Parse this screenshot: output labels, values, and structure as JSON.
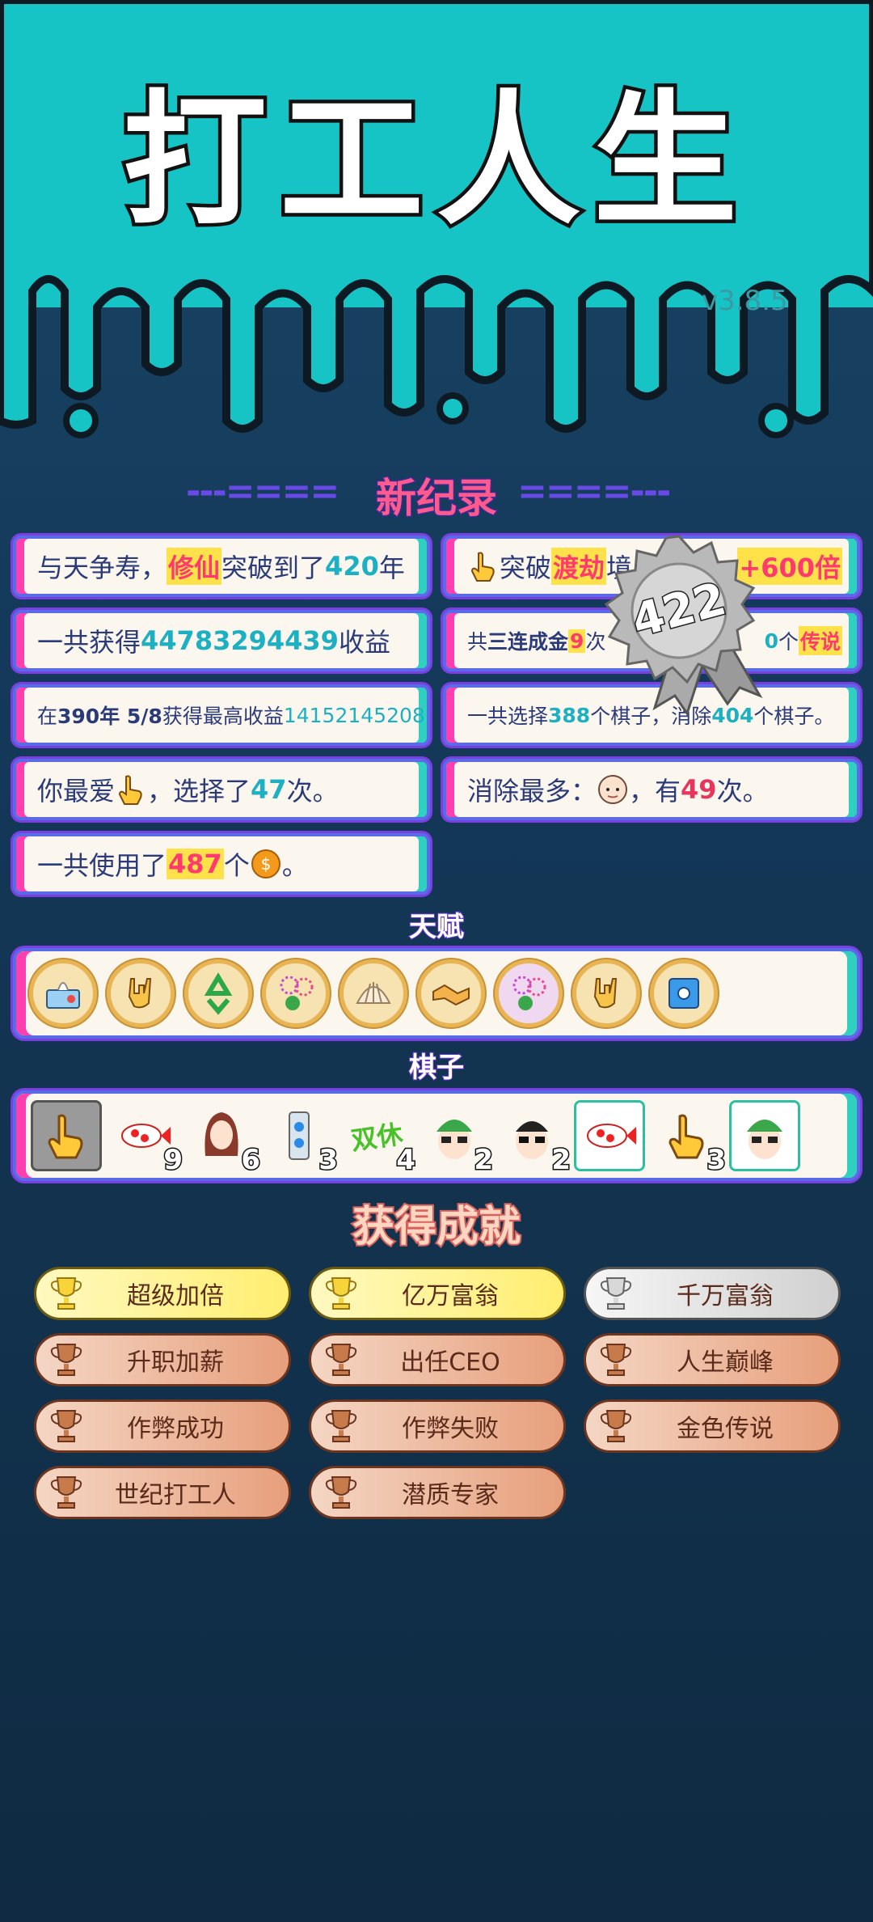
{
  "header": {
    "title": "打工人生",
    "version": "v3.8.5"
  },
  "records": {
    "section_title": "新纪录",
    "deco_left": "---====",
    "deco_right": "====---",
    "badge_number": "422",
    "rows": [
      {
        "pre": "与天争寿，",
        "gold": "修仙",
        "mid": "突破到了",
        "hl": "420",
        "post": "年"
      },
      {
        "pre": "突破",
        "gold": "渡劫",
        "mid": "境",
        "hl": "",
        "post": "+600倍"
      },
      {
        "pre": "一共获得",
        "hl": "44783294439",
        "post": "收益"
      },
      {
        "pre": "共",
        "bold": "三连成金",
        "num": "9",
        "mid": "次",
        "num2": "0",
        "post": "个",
        "gold": "传说"
      },
      {
        "pre": "在 ",
        "bold": "390年 5/8",
        "mid": " 获得最高收益",
        "hl": "14152145208"
      },
      {
        "pre": "一共选择",
        "hl": "388",
        "mid": "个棋子，消除",
        "hl2": "404",
        "post": "个棋子。"
      },
      {
        "pre": "你最爱",
        "mid": "，选择了",
        "hl": "47",
        "post": "次。"
      },
      {
        "pre": "消除最多：",
        "mid": "，有",
        "red": "49",
        "post": "次。"
      },
      {
        "pre": "一共使用了",
        "gold": "487",
        "post": "个",
        "end": "。"
      }
    ]
  },
  "talents": {
    "title": "天赋",
    "icons": [
      "tissue-icon",
      "rock-hand-icon",
      "recycle-icon",
      "fireworks-icon",
      "shell-icon",
      "handshake-icon",
      "fireworks-icon",
      "rock-hand-icon",
      "safe-icon"
    ]
  },
  "pieces": {
    "title": "棋子",
    "items": [
      {
        "icon": "pointer-hand-icon",
        "count": ""
      },
      {
        "icon": "koi-fish-icon",
        "count": "9"
      },
      {
        "icon": "girl-avatar-icon",
        "count": "6"
      },
      {
        "icon": "snowflake-can-icon",
        "count": "3"
      },
      {
        "icon": "double-rest-icon",
        "label": "双休",
        "count": "4"
      },
      {
        "icon": "green-hat-man-icon",
        "count": "2"
      },
      {
        "icon": "sunglasses-man-icon",
        "count": "2"
      },
      {
        "icon": "koi-fish-icon",
        "count": ""
      },
      {
        "icon": "pointer-hand-icon",
        "count": "3"
      },
      {
        "icon": "green-hat-man-icon",
        "count": ""
      }
    ]
  },
  "achievements": {
    "title": "获得成就",
    "items": [
      {
        "label": "超级加倍",
        "tier": "gold"
      },
      {
        "label": "亿万富翁",
        "tier": "gold"
      },
      {
        "label": "千万富翁",
        "tier": "silver"
      },
      {
        "label": "升职加薪",
        "tier": "bronze"
      },
      {
        "label": "出任CEO",
        "tier": "bronze"
      },
      {
        "label": "人生巅峰",
        "tier": "bronze"
      },
      {
        "label": "作弊成功",
        "tier": "bronze"
      },
      {
        "label": "作弊失败",
        "tier": "bronze"
      },
      {
        "label": "金色传说",
        "tier": "bronze"
      },
      {
        "label": "世纪打工人",
        "tier": "bronze"
      },
      {
        "label": "潜质专家",
        "tier": "bronze"
      }
    ]
  }
}
